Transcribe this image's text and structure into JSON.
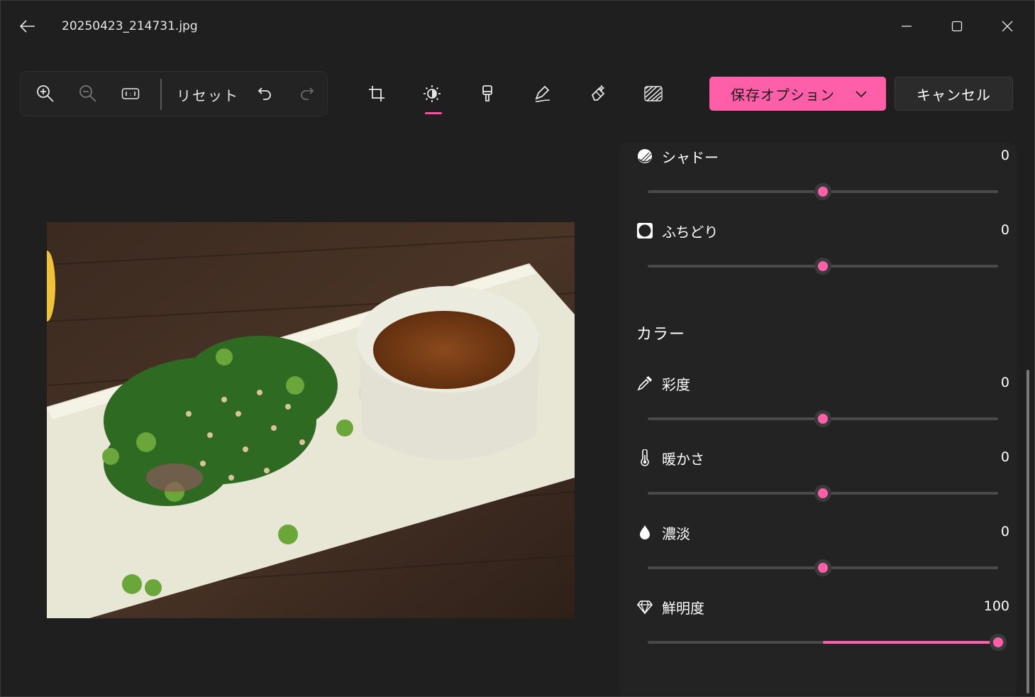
{
  "window": {
    "title": "20250423_214731.jpg"
  },
  "toolbar": {
    "reset_label": "リセット"
  },
  "actions": {
    "save_label": "保存オプション",
    "cancel_label": "キャンセル"
  },
  "panel": {
    "light_rows": [
      {
        "label": "シャドー",
        "value": "0",
        "level": 0.5,
        "icon": "shadow-icon"
      },
      {
        "label": "ふちどり",
        "value": "0",
        "level": 0.5,
        "icon": "vignette-icon"
      }
    ],
    "color_section_title": "カラー",
    "color_rows": [
      {
        "label": "彩度",
        "value": "0",
        "level": 0.5,
        "icon": "eyedropper-icon"
      },
      {
        "label": "暖かさ",
        "value": "0",
        "level": 0.5,
        "icon": "thermometer-icon"
      },
      {
        "label": "濃淡",
        "value": "0",
        "level": 0.5,
        "icon": "drop-icon"
      },
      {
        "label": "鮮明度",
        "value": "100",
        "level": 1.0,
        "icon": "diamond-icon"
      }
    ]
  },
  "colors": {
    "accent": "#ff5ea9",
    "background": "#1f1f1f",
    "panel": "#232323"
  }
}
